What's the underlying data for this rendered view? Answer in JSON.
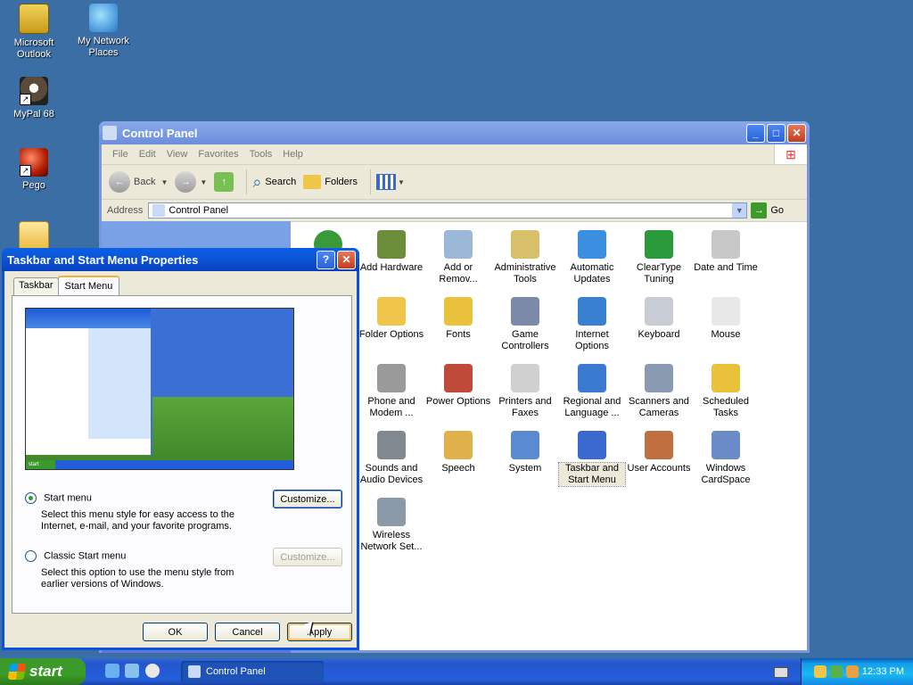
{
  "desktop": {
    "icons": [
      {
        "label": "Microsoft Outlook",
        "icon": "outlook-icon"
      },
      {
        "label": "My Network Places",
        "icon": "network-places-icon"
      },
      {
        "label": "MyPal 68",
        "icon": "mypal-icon"
      },
      {
        "label": "Pego",
        "icon": "pego-icon"
      },
      {
        "label": "",
        "icon": "folder-icon"
      }
    ]
  },
  "control_panel": {
    "title": "Control Panel",
    "menu": [
      "File",
      "Edit",
      "View",
      "Favorites",
      "Tools",
      "Help"
    ],
    "toolbar": {
      "back": "Back",
      "search": "Search",
      "folders": "Folders"
    },
    "address_label": "Address",
    "address_value": "Control Panel",
    "go_label": "Go",
    "items": [
      {
        "label": "Add Hardware",
        "icon": "add-hardware-icon",
        "color": "#6b8e3a"
      },
      {
        "label": "Add or Remov...",
        "icon": "add-remove-programs-icon",
        "color": "#9bb8d8"
      },
      {
        "label": "Administrative Tools",
        "icon": "administrative-tools-icon",
        "color": "#d8c06a"
      },
      {
        "label": "Automatic Updates",
        "icon": "automatic-updates-icon",
        "color": "#3c8ee0"
      },
      {
        "label": "ClearType Tuning",
        "icon": "cleartype-icon",
        "color": "#2a9a3a"
      },
      {
        "label": "Date and Time",
        "icon": "date-time-icon",
        "color": "#c8c8c8"
      },
      {
        "label": "Folder Options",
        "icon": "folder-options-icon",
        "color": "#f0c64a"
      },
      {
        "label": "Fonts",
        "icon": "fonts-icon",
        "color": "#e9c13a"
      },
      {
        "label": "Game Controllers",
        "icon": "game-controllers-icon",
        "color": "#7a8aa8"
      },
      {
        "label": "Internet Options",
        "icon": "internet-options-icon",
        "color": "#3a80d0"
      },
      {
        "label": "Keyboard",
        "icon": "keyboard-icon",
        "color": "#c8ccd4"
      },
      {
        "label": "Mouse",
        "icon": "mouse-icon",
        "color": "#e8e8e8"
      },
      {
        "label": "Phone and Modem ...",
        "icon": "phone-modem-icon",
        "color": "#9a9a9a"
      },
      {
        "label": "Power Options",
        "icon": "power-options-icon",
        "color": "#c04a3a"
      },
      {
        "label": "Printers and Faxes",
        "icon": "printers-faxes-icon",
        "color": "#d0d0d0"
      },
      {
        "label": "Regional and Language ...",
        "icon": "regional-language-icon",
        "color": "#3a7ad0"
      },
      {
        "label": "Scanners and Cameras",
        "icon": "scanners-cameras-icon",
        "color": "#8a9ab0"
      },
      {
        "label": "Scheduled Tasks",
        "icon": "scheduled-tasks-icon",
        "color": "#e9c13a"
      },
      {
        "label": "Sounds and Audio Devices",
        "icon": "sounds-audio-icon",
        "color": "#808890"
      },
      {
        "label": "Speech",
        "icon": "speech-icon",
        "color": "#e0b04a"
      },
      {
        "label": "System",
        "icon": "system-icon",
        "color": "#5a8ad0"
      },
      {
        "label": "Taskbar and Start Menu",
        "icon": "taskbar-start-menu-icon",
        "color": "#3a6ad0"
      },
      {
        "label": "User Accounts",
        "icon": "user-accounts-icon",
        "color": "#c07040"
      },
      {
        "label": "Windows CardSpace",
        "icon": "cardspace-icon",
        "color": "#6a8ac8"
      },
      {
        "label": "Wireless Network Set...",
        "icon": "wireless-network-icon",
        "color": "#8a9aa8"
      }
    ]
  },
  "dialog": {
    "title": "Taskbar and Start Menu Properties",
    "tabs": [
      "Taskbar",
      "Start Menu"
    ],
    "options": [
      {
        "label": "Start menu",
        "desc": "Select this menu style for easy access to the Internet, e-mail, and your favorite programs.",
        "button": "Customize..."
      },
      {
        "label": "Classic Start menu",
        "desc": "Select this option to use the menu style from earlier versions of Windows.",
        "button": "Customize..."
      }
    ],
    "buttons": {
      "ok": "OK",
      "cancel": "Cancel",
      "apply": "Apply"
    }
  },
  "taskbar": {
    "start_label": "start",
    "task_label": "Control Panel",
    "clock": "12:33 PM"
  }
}
